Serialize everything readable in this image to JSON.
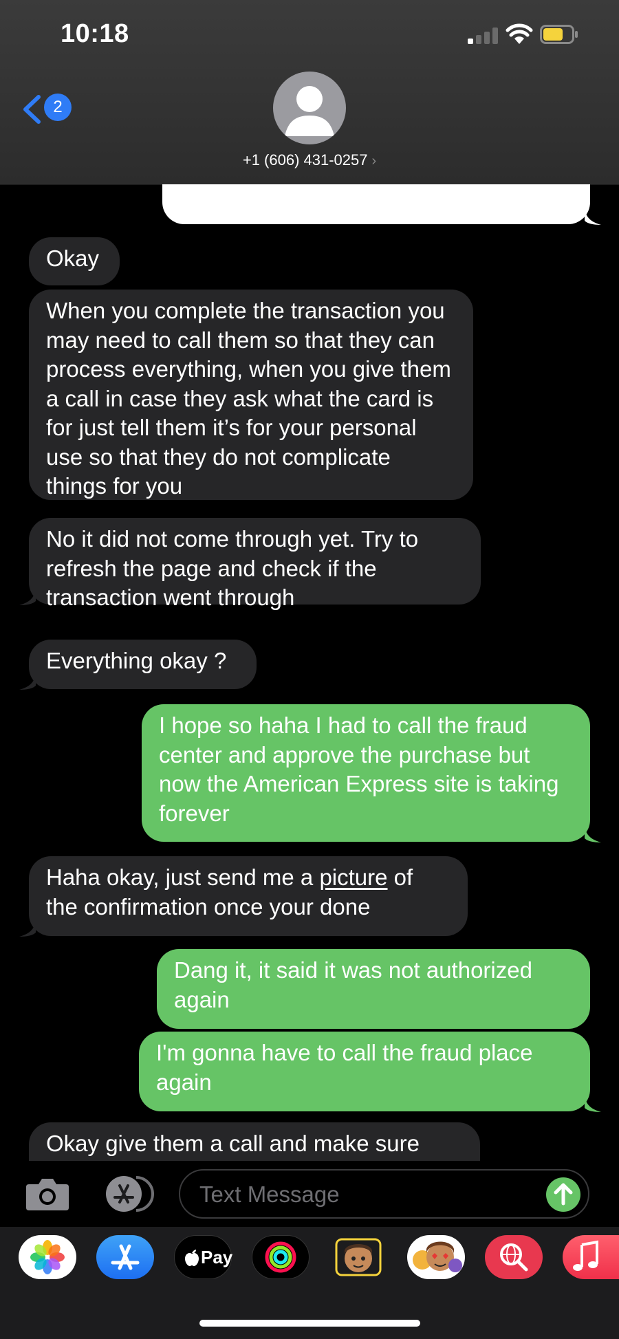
{
  "status": {
    "time": "10:18"
  },
  "header": {
    "back_count": "2",
    "contact": "+1 (606) 431-0257",
    "chevron": "›"
  },
  "messages": [
    {
      "from": "them",
      "text": "Okay"
    },
    {
      "from": "them",
      "text": "When you complete the transaction you may need to call them so that they can process everything, when you give them a call in case they ask what the card is for just tell them it’s for your personal use so that they do not complicate things for you"
    },
    {
      "from": "them",
      "text": "No it did not come through yet. Try to refresh the page and check if the transaction went through"
    },
    {
      "from": "them",
      "text": "Everything okay ?"
    },
    {
      "from": "me",
      "text": "I hope so haha I had to call the fraud center and approve the purchase but now the American Express site is taking forever"
    },
    {
      "from": "them",
      "text_before": "Haha okay, just send me a ",
      "link": "picture",
      "text_after": " of the confirmation once your done"
    },
    {
      "from": "me",
      "text": "Dang it, it said it was not authorized again"
    },
    {
      "from": "me",
      "text": "I'm gonna have to call the fraud place again"
    },
    {
      "from": "them",
      "text": "Okay give them a call and make sure"
    }
  ],
  "compose": {
    "placeholder": "Text Message"
  },
  "drawer": {
    "apps": [
      {
        "name": "photos-app-icon"
      },
      {
        "name": "app-store-app-icon"
      },
      {
        "name": "apple-pay-app-icon",
        "label": "Pay"
      },
      {
        "name": "fitness-app-icon"
      },
      {
        "name": "memoji-app-icon"
      },
      {
        "name": "animoji-stickers-app-icon"
      },
      {
        "name": "search-images-app-icon"
      },
      {
        "name": "music-app-icon"
      }
    ]
  },
  "colors": {
    "outgoing": "#66c466",
    "incoming": "#262628",
    "accent": "#2f7cf6"
  }
}
